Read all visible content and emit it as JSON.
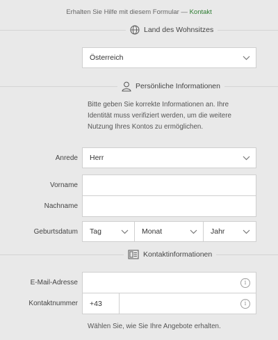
{
  "help": {
    "text": "Erhalten Sie Hilfe mit diesem Formular —",
    "link": "Kontakt"
  },
  "sections": {
    "residence": "Land des Wohnsitzes",
    "personal": "Persönliche Informationen",
    "contact": "Kontaktinformationen"
  },
  "country": {
    "value": "Österreich"
  },
  "personal_intro": [
    "Bitte geben Sie korrekte Informationen an. Ihre",
    "Identität muss verifiziert werden, um die weitere",
    "Nutzung Ihres Kontos zu ermöglichen."
  ],
  "labels": {
    "salutation": "Anrede",
    "first_name": "Vorname",
    "last_name": "Nachname",
    "birthdate": "Geburtsdatum",
    "email": "E-Mail-Adresse",
    "phone": "Kontaktnummer"
  },
  "salutation": {
    "value": "Herr"
  },
  "birthdate": {
    "day": "Tag",
    "month": "Monat",
    "year": "Jahr"
  },
  "phone": {
    "prefix": "+43"
  },
  "info_glyph": "i",
  "offers_text": "Wählen Sie, wie Sie Ihre Angebote erhalten.",
  "icons": [
    "globe-icon",
    "person-icon",
    "contact-card-icon",
    "chevron-down-icon",
    "info-icon"
  ]
}
